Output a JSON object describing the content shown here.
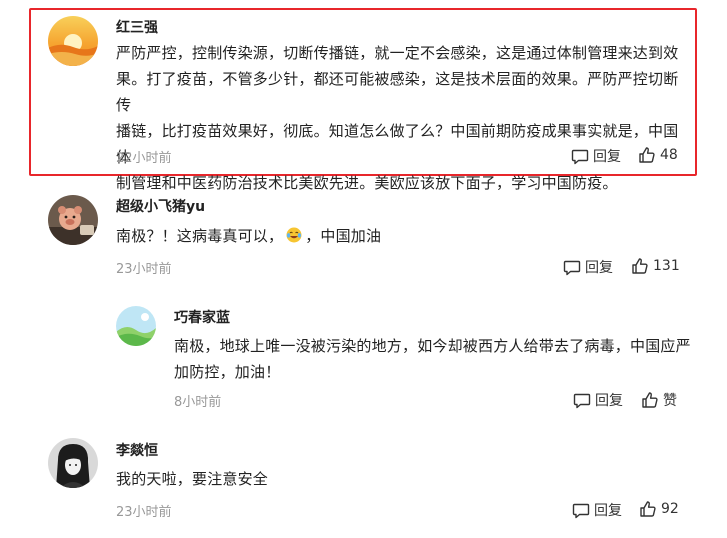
{
  "comments": [
    {
      "username": "红三强",
      "text_lines": [
        "严防严控，控制传染源，切断传播链，就一定不会感染，这是通过体制管理来达到效",
        "果。打了疫苗，不管多少针，都还可能被感染，这是技术层面的效果。严防严控切断传",
        "播链，比打疫苗效果好，彻底。知道怎么做了么？中国前期防疫成果事实就是，中国体",
        "制管理和中医药防治技术比美欧先进。美欧应该放下面子，学习中国防疫。"
      ],
      "time": "22小时前",
      "reply_label": "回复",
      "like_count": "48",
      "highlighted": true
    },
    {
      "username": "超级小飞猪yu",
      "text_before_emoji": "南极？！这病毒真可以，",
      "text_after_emoji": "，中国加油",
      "time": "23小时前",
      "reply_label": "回复",
      "like_count": "131"
    },
    {
      "username": "巧春家蓝",
      "text_lines": [
        "南极，地球上唯一没被污染的地方，如今却被西方人给带去了病毒，中国应严",
        "加防控，加油！"
      ],
      "time": "8小时前",
      "reply_label": "回复",
      "like_count": "赞",
      "is_reply": true
    },
    {
      "username": "李燚恒",
      "text": "我的天啦，要注意安全",
      "time": "23小时前",
      "reply_label": "回复",
      "like_count": "92"
    }
  ],
  "colors": {
    "highlight_border": "#e8262b",
    "time_text": "#999999",
    "main_text": "#222222"
  },
  "icons": {
    "reply": "comment-bubble-icon",
    "like": "thumbs-up-icon",
    "emoji": "laughing-crying-emoji"
  }
}
